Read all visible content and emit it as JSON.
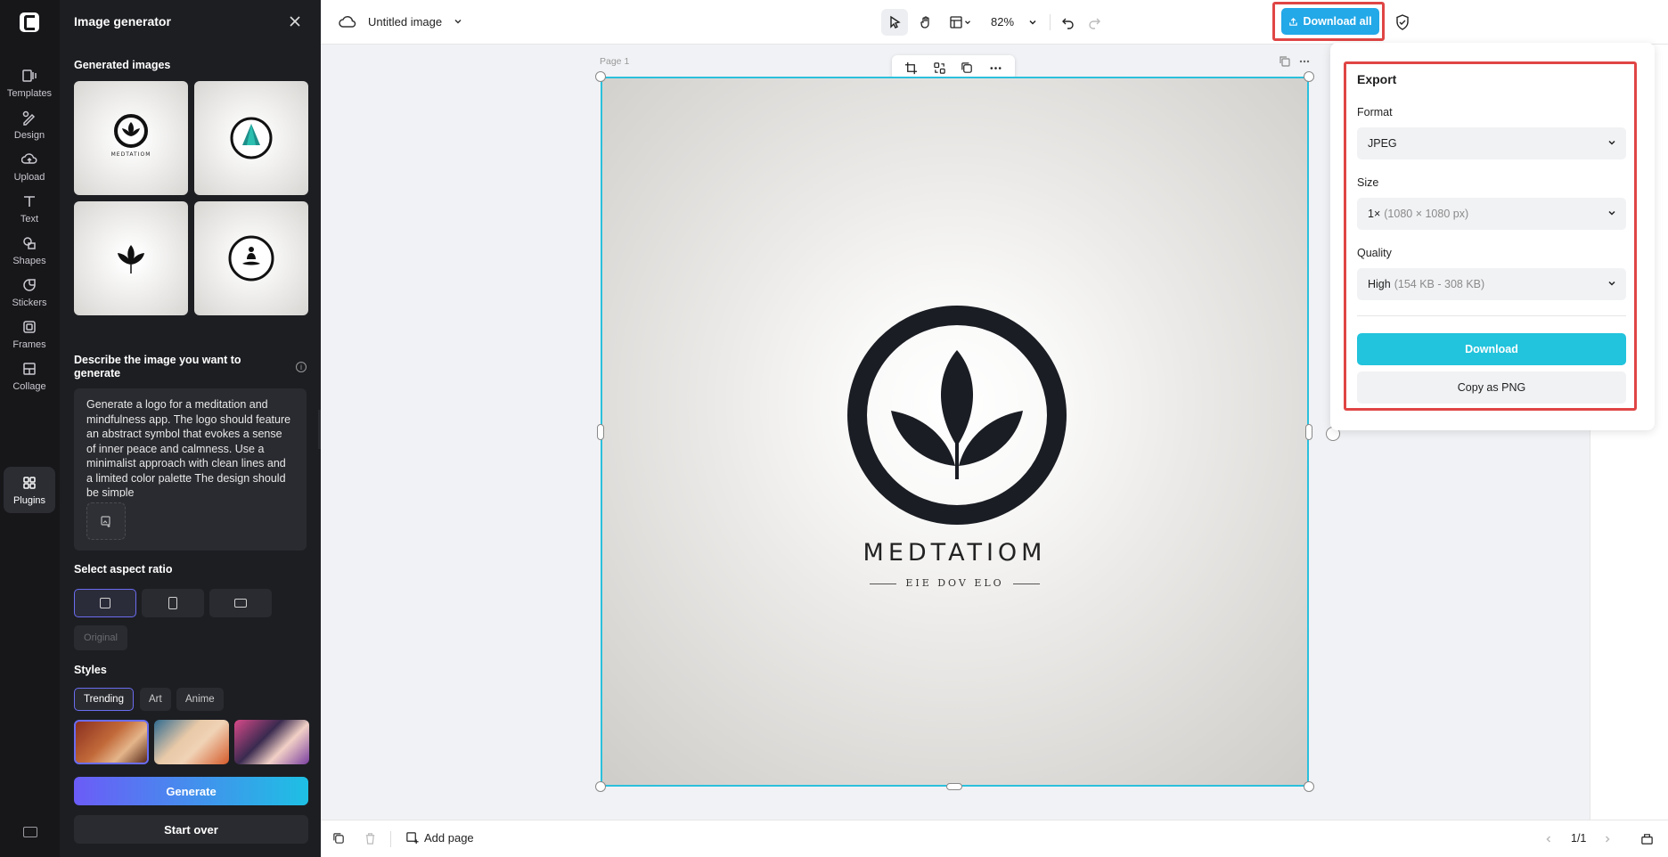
{
  "rail": {
    "items": [
      {
        "label": "Templates",
        "icon": "templates-icon"
      },
      {
        "label": "Design",
        "icon": "design-icon"
      },
      {
        "label": "Upload",
        "icon": "upload-icon"
      },
      {
        "label": "Text",
        "icon": "text-icon"
      },
      {
        "label": "Shapes",
        "icon": "shapes-icon"
      },
      {
        "label": "Stickers",
        "icon": "stickers-icon"
      },
      {
        "label": "Frames",
        "icon": "frames-icon"
      },
      {
        "label": "Collage",
        "icon": "collage-icon"
      },
      {
        "label": "Plugins",
        "icon": "plugins-icon"
      }
    ]
  },
  "panel": {
    "title": "Image generator",
    "generated_label": "Generated images",
    "describe_label": "Describe the image you want to generate",
    "prompt": "Generate a logo for a meditation and mindfulness app. The logo should feature an abstract symbol that evokes a sense of inner peace and calmness. Use a minimalist approach with clean lines and a limited color palette The design should be simple",
    "aspect_label": "Select aspect ratio",
    "original_label": "Original",
    "styles_label": "Styles",
    "style_tabs": [
      "Trending",
      "Art",
      "Anime"
    ],
    "generate_label": "Generate",
    "startover_label": "Start over",
    "thumb1_text": "MEDTATIOM"
  },
  "topbar": {
    "doc_title": "Untitled image",
    "zoom": "82%",
    "download_all": "Download all"
  },
  "canvas": {
    "page_label": "Page 1",
    "logo_word": "MEDTATIOM",
    "logo_sub": "EIE DOV ELO",
    "accent": "#2bc0dc"
  },
  "bottombar": {
    "add_page": "Add page",
    "pager": "1/1"
  },
  "export": {
    "title": "Export",
    "format_label": "Format",
    "format_value": "JPEG",
    "size_label": "Size",
    "size_value": "1×",
    "size_detail": "(1080 × 1080 px)",
    "quality_label": "Quality",
    "quality_value": "High",
    "quality_detail": "(154 KB - 308 KB)",
    "download_label": "Download",
    "copy_label": "Copy as PNG"
  }
}
